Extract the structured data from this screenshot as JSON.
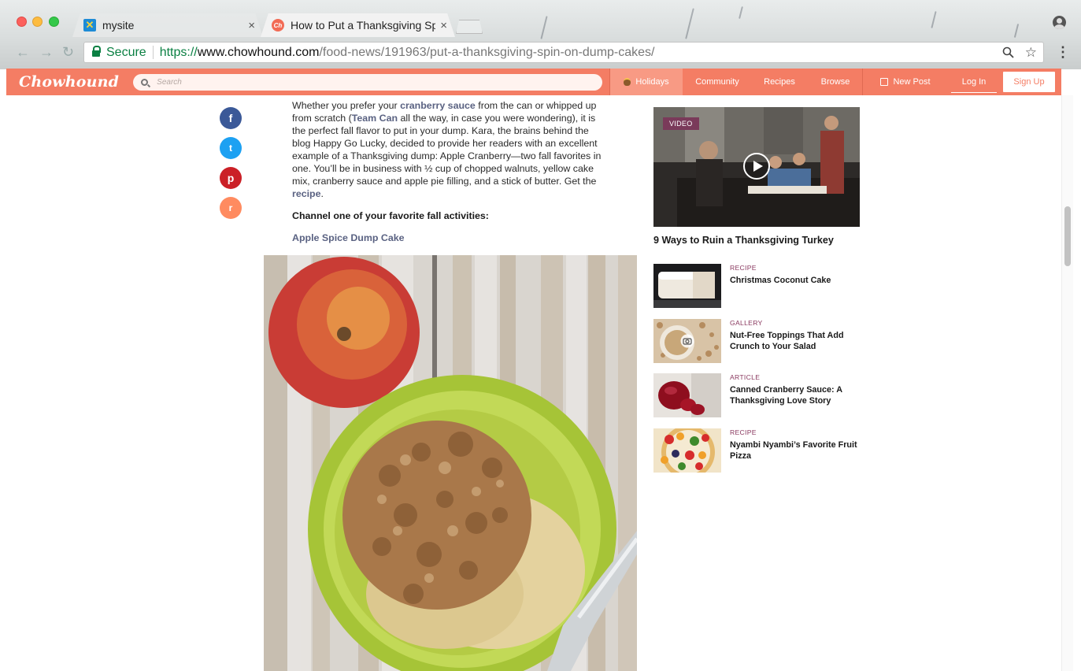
{
  "browser": {
    "tabs": [
      {
        "title": "mysite",
        "close": "×"
      },
      {
        "title": "How to Put a Thanksgiving Spin",
        "close": "×"
      }
    ],
    "url": {
      "secure_label": "Secure",
      "scheme": "https://",
      "host": "www.chowhound.com",
      "path": "/food-news/191963/put-a-thanksgiving-spin-on-dump-cakes/"
    }
  },
  "header": {
    "logo": "Chowhound",
    "search_placeholder": "Search",
    "nav": {
      "holidays": "Holidays",
      "community": "Community",
      "recipes": "Recipes",
      "browse": "Browse",
      "new_post": "New Post",
      "log_in": "Log In",
      "sign_up": "Sign Up"
    },
    "accent": "#f47d64"
  },
  "share": {
    "facebook": "f",
    "twitter": "t",
    "pinterest": "p",
    "reddit": "r"
  },
  "article": {
    "p1": {
      "t1": "Whether you prefer your ",
      "link1": "cranberry sauce",
      "t2": " from the can or whipped up from scratch (",
      "link2": "Team Can",
      "t3": " all the way, in case you were wondering), it is the perfect fall flavor to put in your dump. Kara, the brains behind the blog Happy Go Lucky, decided to provide her readers with an excellent example of a Thanksgiving dump: Apple Cranberry—two fall favorites in one. You’ll be in business with ½ cup of chopped walnuts, yellow cake mix, cranberry sauce and apple pie filling, and a stick of butter. Get the ",
      "link3": "recipe",
      "t4": "."
    },
    "heading": "Channel one of your favorite fall activities:",
    "link": "Apple Spice Dump Cake"
  },
  "sidebar": {
    "video": {
      "badge": "VIDEO",
      "title": "9 Ways to Ruin a Thanksgiving Turkey"
    },
    "items": [
      {
        "category": "RECIPE",
        "title": "Christmas Coconut Cake"
      },
      {
        "category": "GALLERY",
        "title": "Nut-Free Toppings That Add Crunch to Your Salad"
      },
      {
        "category": "ARTICLE",
        "title": "Canned Cranberry Sauce: A Thanksgiving Love Story"
      },
      {
        "category": "RECIPE",
        "title": "Nyambi Nyambi’s Favorite Fruit Pizza"
      }
    ]
  }
}
